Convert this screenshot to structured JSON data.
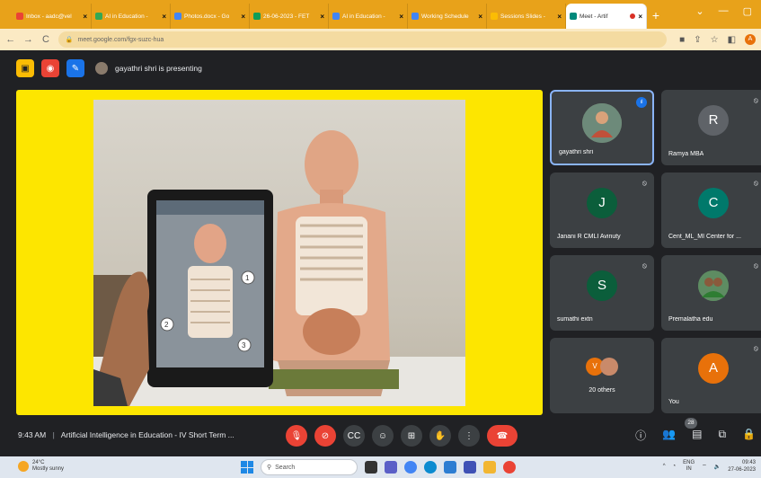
{
  "browser": {
    "tabs": [
      {
        "label": "Inbox - aadc@vel",
        "color": "#ea4335"
      },
      {
        "label": "AI in Education -",
        "color": "#34a853"
      },
      {
        "label": "Photos.docx - Go",
        "color": "#4285f4"
      },
      {
        "label": "26-06-2023 - FET",
        "color": "#0f9d58"
      },
      {
        "label": "AI in Education -",
        "color": "#4285f4"
      },
      {
        "label": "Working Schedule",
        "color": "#4285f4"
      },
      {
        "label": "Sessions Slides -",
        "color": "#fbbc04"
      }
    ],
    "active_tab": {
      "label": "Meet - Artif"
    },
    "url": "meet.google.com/fgx-suzc-hua",
    "profile_initial": "A"
  },
  "meet": {
    "presenting_text": "gayathri shri is presenting",
    "meeting_time": "9:43 AM",
    "meeting_title": "Artificial Intelligence in Education - IV Short Term ...",
    "participants_count": "28",
    "participants": [
      {
        "name": "gayathri shri",
        "initial": "",
        "color": "#7a8b6a",
        "type": "photo"
      },
      {
        "name": "Ramya MBA",
        "initial": "R",
        "color": "#5f6368",
        "type": "letter"
      },
      {
        "name": "Janani R CMLI Avinuty",
        "initial": "J",
        "color": "#0b5e3b",
        "type": "letter"
      },
      {
        "name": "Cent_ML_MI Center for ...",
        "initial": "C",
        "color": "#00796b",
        "type": "letter"
      },
      {
        "name": "sumathi extn",
        "initial": "S",
        "color": "#0b5e3b",
        "type": "letter"
      },
      {
        "name": "Premalatha edu",
        "initial": "",
        "color": "#4e7c5a",
        "type": "photo"
      },
      {
        "name": "20 others",
        "initial": "V",
        "color": "#e8710a",
        "type": "others"
      },
      {
        "name": "You",
        "initial": "A",
        "color": "#e8710a",
        "type": "letter"
      }
    ]
  },
  "taskbar": {
    "temp": "24°C",
    "weather": "Mostly sunny",
    "search_placeholder": "Search",
    "lang": "ENG",
    "region": "IN",
    "time": "09:43",
    "date": "27-06-2023"
  }
}
